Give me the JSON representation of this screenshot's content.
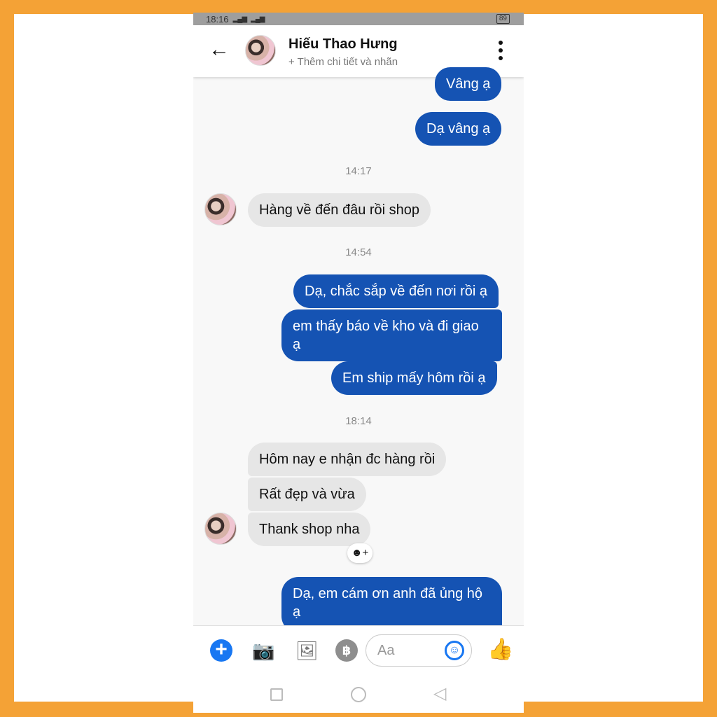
{
  "status_bar": {
    "time": "18:16",
    "signal": "▂▄▆",
    "battery": "89"
  },
  "header": {
    "back_icon": "←",
    "name": "Hiếu Thao Hưng",
    "subtitle": "+ Thêm chi tiết và nhãn"
  },
  "messages": {
    "m1": "Vâng ạ",
    "m2": "Dạ vâng ạ",
    "t1": "14:17",
    "m3": "Hàng về đến đâu rồi shop",
    "t2": "14:54",
    "m4": "Dạ, chắc sắp về đến nơi rồi ạ",
    "m5a": "em thấy báo về kho và đi giao",
    "m5b": "ạ",
    "m6": "Em ship mấy hôm rồi ạ",
    "t3": "18:14",
    "m7": "Hôm nay e nhận đc hàng rồi",
    "m8": "Rất đẹp và vừa",
    "m9": "Thank shop nha",
    "m10a": "Dạ, em cám ơn anh đã ủng hộ",
    "m10b": "ạ"
  },
  "reaction": {
    "label": "☻+"
  },
  "composer": {
    "plus_icon": "+",
    "camera_icon": "📷",
    "image_icon": "🖼",
    "pay_icon": "฿",
    "placeholder": "Aa",
    "emoji_icon": "☺",
    "like_icon": "👍"
  }
}
